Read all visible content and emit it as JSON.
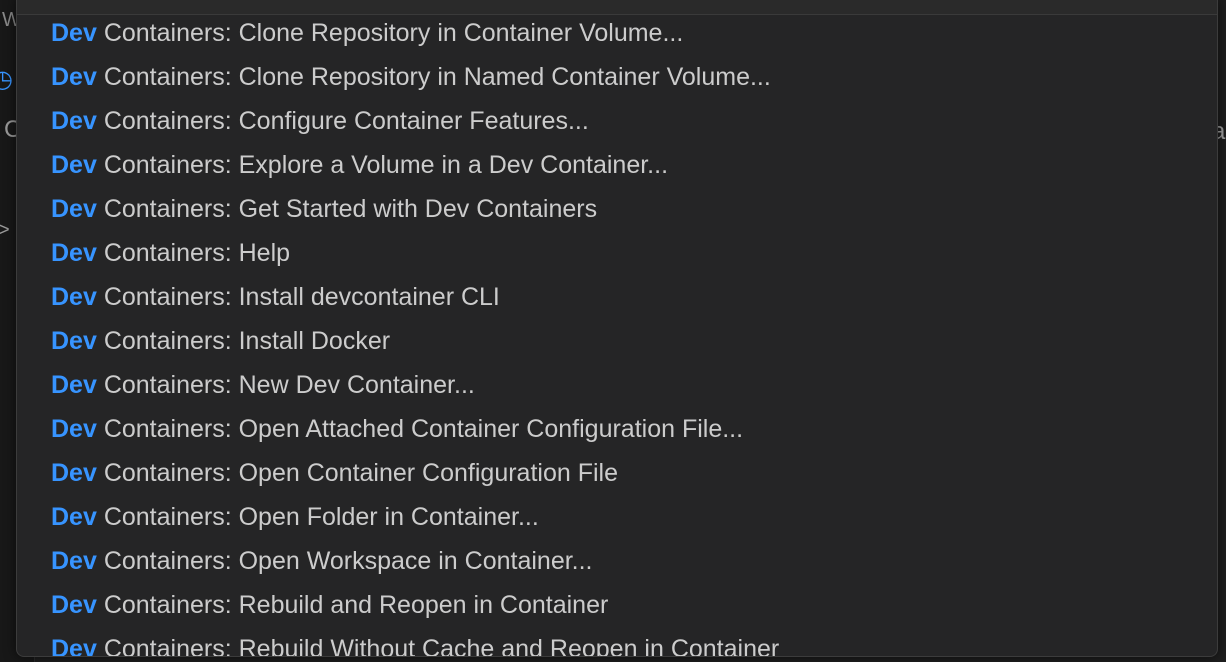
{
  "background": {
    "top_glyph": "W",
    "side_glyph_c": "C",
    "side_glyph_chevron": ">",
    "right_glyph": "a",
    "icons": [
      "history-icon"
    ]
  },
  "quick_pick": {
    "highlight_color": "#3794ff",
    "items": [
      {
        "match": "Dev",
        "rest": " Containers: Clone Repository in Container Volume..."
      },
      {
        "match": "Dev",
        "rest": " Containers: Clone Repository in Named Container Volume..."
      },
      {
        "match": "Dev",
        "rest": " Containers: Configure Container Features..."
      },
      {
        "match": "Dev",
        "rest": " Containers: Explore a Volume in a Dev Container..."
      },
      {
        "match": "Dev",
        "rest": " Containers: Get Started with Dev Containers"
      },
      {
        "match": "Dev",
        "rest": " Containers: Help"
      },
      {
        "match": "Dev",
        "rest": " Containers: Install devcontainer CLI"
      },
      {
        "match": "Dev",
        "rest": " Containers: Install Docker"
      },
      {
        "match": "Dev",
        "rest": " Containers: New Dev Container..."
      },
      {
        "match": "Dev",
        "rest": " Containers: Open Attached Container Configuration File..."
      },
      {
        "match": "Dev",
        "rest": " Containers: Open Container Configuration File"
      },
      {
        "match": "Dev",
        "rest": " Containers: Open Folder in Container..."
      },
      {
        "match": "Dev",
        "rest": " Containers: Open Workspace in Container..."
      },
      {
        "match": "Dev",
        "rest": " Containers: Rebuild and Reopen in Container"
      },
      {
        "match": "Dev",
        "rest": " Containers: Rebuild Without Cache and Reopen in Container"
      }
    ]
  }
}
